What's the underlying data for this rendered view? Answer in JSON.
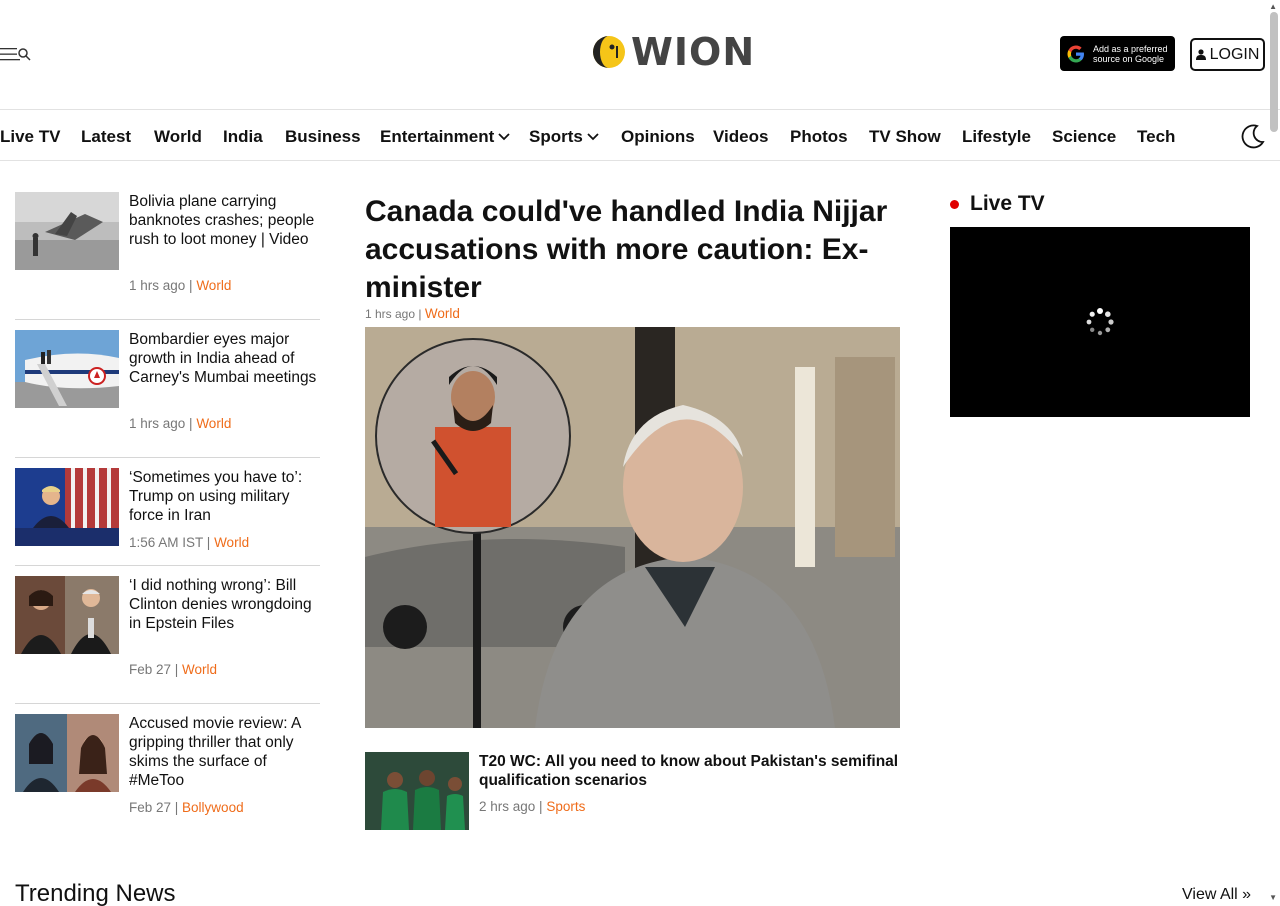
{
  "header": {
    "logo_text": "WION",
    "google_badge": {
      "line1": "Add as a preferred",
      "line2": "source on Google"
    },
    "login_label": "LOGIN"
  },
  "nav": {
    "items": [
      {
        "label": "Live TV"
      },
      {
        "label": "Latest"
      },
      {
        "label": "World"
      },
      {
        "label": "India"
      },
      {
        "label": "Business"
      },
      {
        "label": "Entertainment",
        "dropdown": true
      },
      {
        "label": "Sports",
        "dropdown": true
      },
      {
        "label": "Opinions"
      },
      {
        "label": "Videos"
      },
      {
        "label": "Photos"
      },
      {
        "label": "TV Show"
      },
      {
        "label": "Lifestyle"
      },
      {
        "label": "Science"
      },
      {
        "label": "Tech"
      }
    ]
  },
  "left_stories": [
    {
      "title": "Bolivia plane carrying banknotes crashes; people rush to loot money | Video",
      "time": "1 hrs ago",
      "category": "World"
    },
    {
      "title": "Bombardier eyes major growth in India ahead of Carney's Mumbai meetings",
      "time": "1 hrs ago",
      "category": "World"
    },
    {
      "title": "‘Sometimes you have to’: Trump on using military force in Iran",
      "time": "1:56 AM IST",
      "category": "World"
    },
    {
      "title": "‘I did nothing wrong’: Bill Clinton denies wrongdoing in Epstein Files",
      "time": "Feb 27",
      "category": "World"
    },
    {
      "title": "Accused movie review: A gripping thriller that only skims the surface of #MeToo",
      "time": "Feb 27",
      "category": "Bollywood"
    }
  ],
  "main_story": {
    "headline": "Canada could've handled India Nijjar accusations with more caution: Ex-minister",
    "time": "1 hrs ago",
    "category": "World"
  },
  "sub_story": {
    "title": "T20 WC: All you need to know about Pakistan's semifinal qualification scenarios",
    "time": "2 hrs ago",
    "category": "Sports"
  },
  "live_tv": {
    "title": "Live TV"
  },
  "trending": {
    "title": "Trending News",
    "view_all": "View All »"
  },
  "colors": {
    "accent": "#ef6c1a",
    "live_red": "#e00000",
    "logo_yellow": "#f5c518"
  }
}
